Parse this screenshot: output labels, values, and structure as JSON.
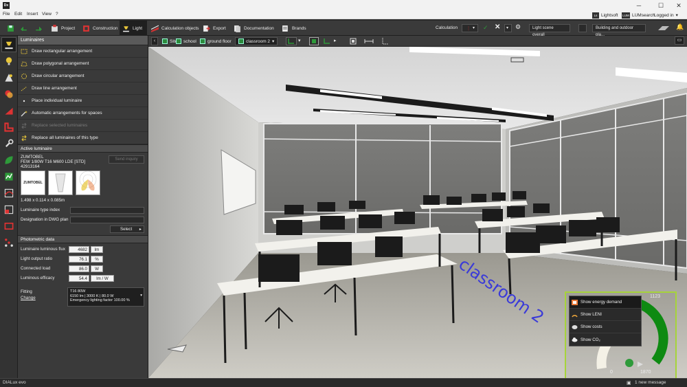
{
  "app": {
    "logo": "Dx",
    "window_minimize": "─",
    "window_maximize": "☐",
    "window_close": "✕"
  },
  "menu": {
    "items": [
      "File",
      "Edit",
      "Insert",
      "View",
      "?"
    ],
    "lightsoft": "Lightsoft",
    "lumsearch": "LUMsearch",
    "login": "Logged in",
    "lightsoft_badge": "Ls",
    "lumsearch_badge": "LUM"
  },
  "toolbar": {
    "tabs": [
      "Project",
      "Construction",
      "Light",
      "Calculation objects",
      "Export",
      "Documentation",
      "Brands"
    ],
    "active_tab": "Light",
    "calculation_label": "Calculation",
    "scene_select": "Light scene overall",
    "view_select": "Building and outdoor pla..."
  },
  "breadcrumb": {
    "items": [
      "Site",
      "school",
      "ground floor",
      "classroom 2"
    ]
  },
  "panel": {
    "title": "Luminaires",
    "actions": [
      {
        "label": "Draw rectangular arrangement",
        "enabled": true
      },
      {
        "label": "Draw polygonal arrangement",
        "enabled": true
      },
      {
        "label": "Draw circular arrangement",
        "enabled": true
      },
      {
        "label": "Draw line arrangement",
        "enabled": true
      },
      {
        "label": "Place individual luminaire",
        "enabled": true
      },
      {
        "label": "Automatic arrangements for spaces",
        "enabled": true
      },
      {
        "label": "Replace selected luminaires",
        "enabled": false
      },
      {
        "label": "Replace all luminaires of this type",
        "enabled": true
      }
    ],
    "active_luminaire_title": "Active luminaire",
    "manufacturer": "ZUMTOBEL",
    "model": "FEW 1/80W T16 M600 LDE [STD]",
    "article": "42913164",
    "send_inquiry": "Send inquiry",
    "brand_logo": "ZUMTOBEL",
    "dimensions": "1.498 x 0.114 x 0.085m",
    "type_index_label": "Luminaire type index",
    "designation_label": "Designation in DWG plan",
    "select_button": "Select",
    "photometric_title": "Photometric data",
    "photometric": [
      {
        "label": "Luminaire luminous flux",
        "value": "4682",
        "unit": "lm"
      },
      {
        "label": "Light output ratio",
        "value": "76.1",
        "unit": "%"
      },
      {
        "label": "Connected load",
        "value": "86.0",
        "unit": "W"
      },
      {
        "label": "Luminous efficacy",
        "value": "54.4",
        "unit": "lm / W"
      }
    ],
    "fitting_label": "Fitting",
    "fitting_change": "Change",
    "fitting_line1": "T16  80W",
    "fitting_line2": "6150 lm  |  3000 K  |  80.0 W",
    "fitting_line3": "Emergency lighting factor 100.00 %"
  },
  "viewport": {
    "room_label": "classroom 2"
  },
  "energy": {
    "menu": [
      "Show energy demand",
      "Show LENI",
      "Show costs",
      "Show CO₂"
    ],
    "selected": "Show energy demand",
    "gauge_min": "0",
    "gauge_top": "1123",
    "gauge_max": "1870"
  },
  "status": {
    "product": "DIALux evo",
    "message": "1 new message"
  },
  "colors": {
    "accent_green": "#a6d43a",
    "gauge_green": "#0e8a12"
  }
}
